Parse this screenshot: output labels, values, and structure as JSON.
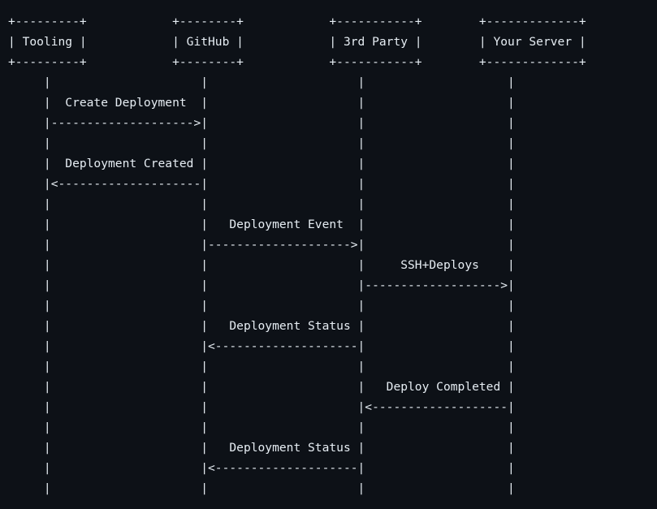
{
  "diagram": {
    "lines": [
      "+---------+            +--------+            +-----------+        +-------------+",
      "| Tooling |            | GitHub |            | 3rd Party |        | Your Server |",
      "+---------+            +--------+            +-----------+        +-------------+",
      "     |                     |                     |                    |",
      "     |  Create Deployment  |                     |                    |",
      "     |-------------------->|                     |                    |",
      "     |                     |                     |                    |",
      "     |  Deployment Created |                     |                    |",
      "     |<--------------------|                     |                    |",
      "     |                     |                     |                    |",
      "     |                     |   Deployment Event  |                    |",
      "     |                     |-------------------->|                    |",
      "     |                     |                     |     SSH+Deploys    |",
      "     |                     |                     |------------------->|",
      "     |                     |                     |                    |",
      "     |                     |   Deployment Status |                    |",
      "     |                     |<--------------------|                    |",
      "     |                     |                     |                    |",
      "     |                     |                     |   Deploy Completed |",
      "     |                     |                     |<-------------------|",
      "     |                     |                     |                    |",
      "     |                     |   Deployment Status |                    |",
      "     |                     |<--------------------|                    |",
      "     |                     |                     |                    |"
    ]
  }
}
